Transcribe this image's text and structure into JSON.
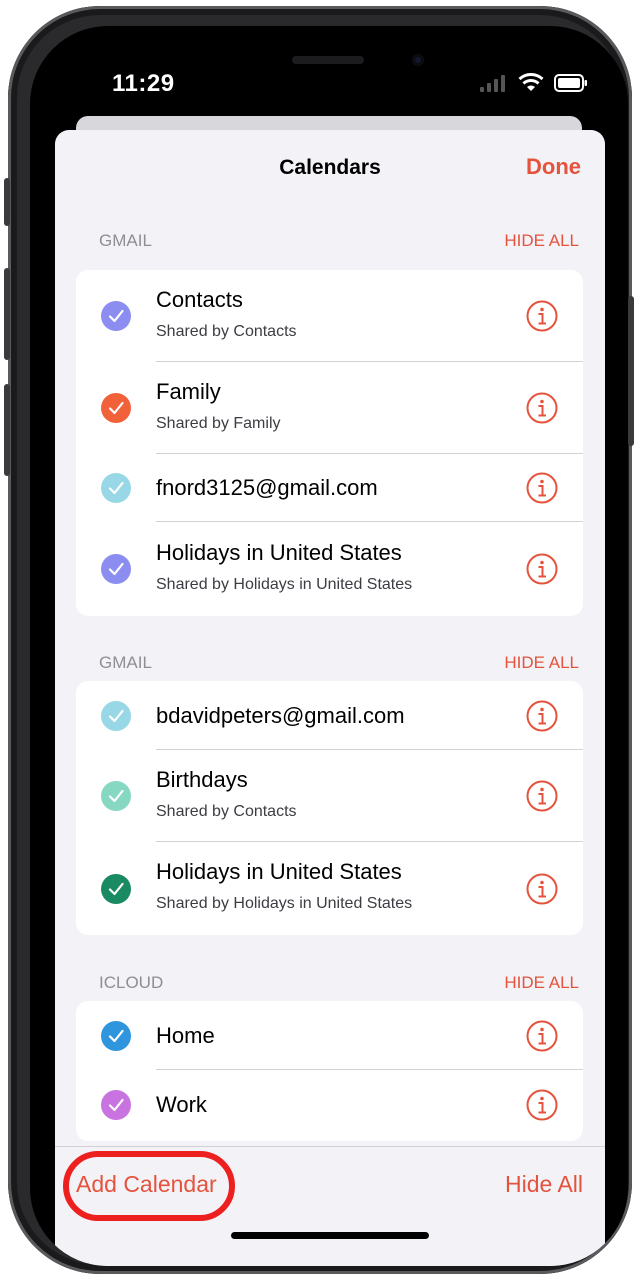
{
  "status_bar": {
    "time": "11:29"
  },
  "header": {
    "title": "Calendars",
    "done_label": "Done"
  },
  "sections": [
    {
      "name": "GMAIL",
      "hide_label": "HIDE ALL",
      "items": [
        {
          "title": "Contacts",
          "subtitle": "Shared by Contacts",
          "color": "#8b8ef0"
        },
        {
          "title": "Family",
          "subtitle": "Shared by Family",
          "color": "#f2623a"
        },
        {
          "title": "fnord3125@gmail.com",
          "subtitle": "",
          "color": "#98d8e6"
        },
        {
          "title": "Holidays in United States",
          "subtitle": "Shared by Holidays in United States",
          "color": "#8b8ef0"
        }
      ]
    },
    {
      "name": "GMAIL",
      "hide_label": "HIDE ALL",
      "items": [
        {
          "title": "bdavidpeters@gmail.com",
          "subtitle": "",
          "color": "#98d8e6"
        },
        {
          "title": "Birthdays",
          "subtitle": "Shared by Contacts",
          "color": "#86d8c2"
        },
        {
          "title": "Holidays in United States",
          "subtitle": "Shared by Holidays in United States",
          "color": "#1a8a62"
        }
      ]
    },
    {
      "name": "ICLOUD",
      "hide_label": "HIDE ALL",
      "items": [
        {
          "title": "Home",
          "subtitle": "",
          "color": "#2f95dc"
        },
        {
          "title": "Work",
          "subtitle": "",
          "color": "#c873df"
        }
      ]
    }
  ],
  "footer": {
    "add_calendar_label": "Add Calendar",
    "hide_all_label": "Hide All"
  },
  "icons": {
    "check": "checkmark-icon",
    "info": "info-icon"
  },
  "colors": {
    "accent": "#e5533d",
    "annotation_circle": "#ee1f1f"
  }
}
